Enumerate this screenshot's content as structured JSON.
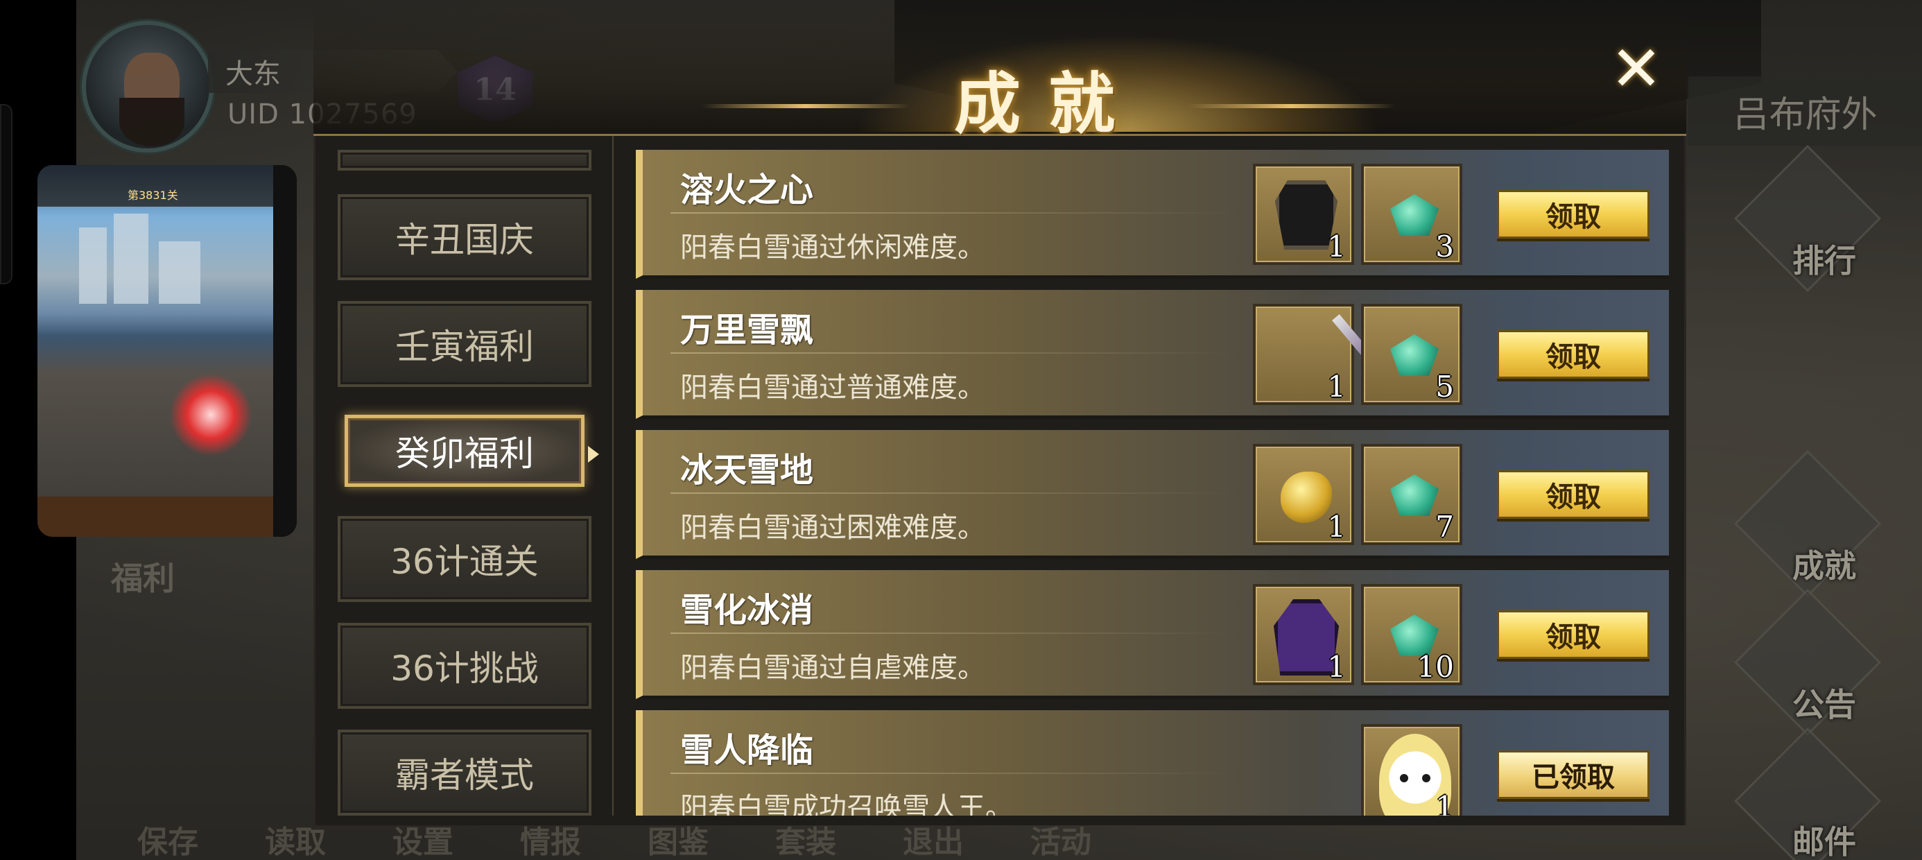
{
  "player": {
    "name": "大东",
    "uid": "UID  1027569",
    "level": "14"
  },
  "location": "吕布府外",
  "side_menu": [
    "排行",
    "成就",
    "公告",
    "邮件"
  ],
  "bottom_menu": [
    "保存",
    "读取",
    "设置",
    "情报",
    "图鉴",
    "套装",
    "退出",
    "活动"
  ],
  "left_label": "福利",
  "mini_preview": {
    "score": "第3831关"
  },
  "panel": {
    "title": "成就",
    "close_icon": "close-icon"
  },
  "categories": [
    {
      "label": "",
      "state": "partial"
    },
    {
      "label": "辛丑国庆",
      "state": "normal"
    },
    {
      "label": "壬寅福利",
      "state": "normal"
    },
    {
      "label": "癸卯福利",
      "state": "active"
    },
    {
      "label": "36计通关",
      "state": "normal"
    },
    {
      "label": "36计挑战",
      "state": "normal"
    },
    {
      "label": "霸者模式",
      "state": "normal"
    }
  ],
  "achievements": [
    {
      "title": "溶火之心",
      "desc": "阳春白雪通过休闲难度。",
      "rewards": [
        {
          "icon": "black-armor-icon",
          "count": "1"
        },
        {
          "icon": "green-gem-icon",
          "count": "3"
        }
      ],
      "button": "领取"
    },
    {
      "title": "万里雪飘",
      "desc": "阳春白雪通过普通难度。",
      "rewards": [
        {
          "icon": "spear-icon",
          "count": "1"
        },
        {
          "icon": "green-gem-icon",
          "count": "5"
        }
      ],
      "button": "领取"
    },
    {
      "title": "冰天雪地",
      "desc": "阳春白雪通过困难难度。",
      "rewards": [
        {
          "icon": "gold-ingot-icon",
          "count": "1"
        },
        {
          "icon": "green-gem-icon",
          "count": "7"
        }
      ],
      "button": "领取"
    },
    {
      "title": "雪化冰消",
      "desc": "阳春白雪通过自虐难度。",
      "rewards": [
        {
          "icon": "purple-robe-icon",
          "count": "1"
        },
        {
          "icon": "green-gem-icon",
          "count": "10"
        }
      ],
      "button": "领取"
    },
    {
      "title": "雪人降临",
      "desc": "阳春白雪成功召唤雪人王。",
      "rewards": [
        {
          "icon": "snowman-icon",
          "count": "1"
        }
      ],
      "button": "已领取"
    }
  ],
  "colors": {
    "accent_gold": "#e2c57a",
    "button_yellow": "#f4d04e",
    "panel_bg": "#1f1d1a"
  }
}
